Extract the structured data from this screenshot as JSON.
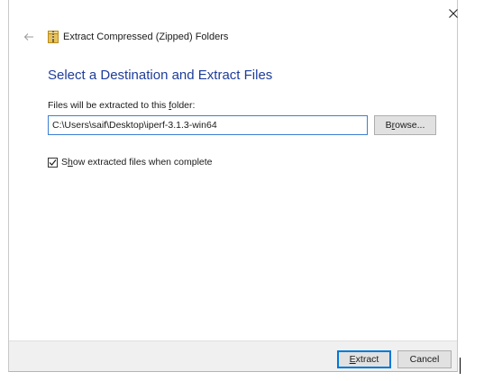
{
  "window": {
    "title": "Extract Compressed (Zipped) Folders",
    "close_glyph": "×",
    "back_glyph": "←"
  },
  "main": {
    "heading": "Select a Destination and Extract Files",
    "folder_label_pre": "Files will be extracted to this ",
    "folder_label_accel": "f",
    "folder_label_post": "older:",
    "path_value": "C:\\Users\\saif\\Desktop\\iperf-3.1.3-win64",
    "browse_pre": "B",
    "browse_accel": "r",
    "browse_post": "owse...",
    "checkbox": {
      "checked": true,
      "label_pre": "S",
      "label_accel": "h",
      "label_post": "ow extracted files when complete"
    }
  },
  "footer": {
    "extract_accel": "E",
    "extract_post": "xtract",
    "cancel_label": "Cancel"
  },
  "colors": {
    "heading": "#1e3d9a",
    "input_border": "#3c7fd1",
    "default_button_border": "#0078d7",
    "footer_bg": "#f0f0f0"
  },
  "icons": {
    "title": "zip-folder-icon",
    "back": "back-arrow-icon",
    "close": "close-icon",
    "check": "checkmark-icon"
  }
}
